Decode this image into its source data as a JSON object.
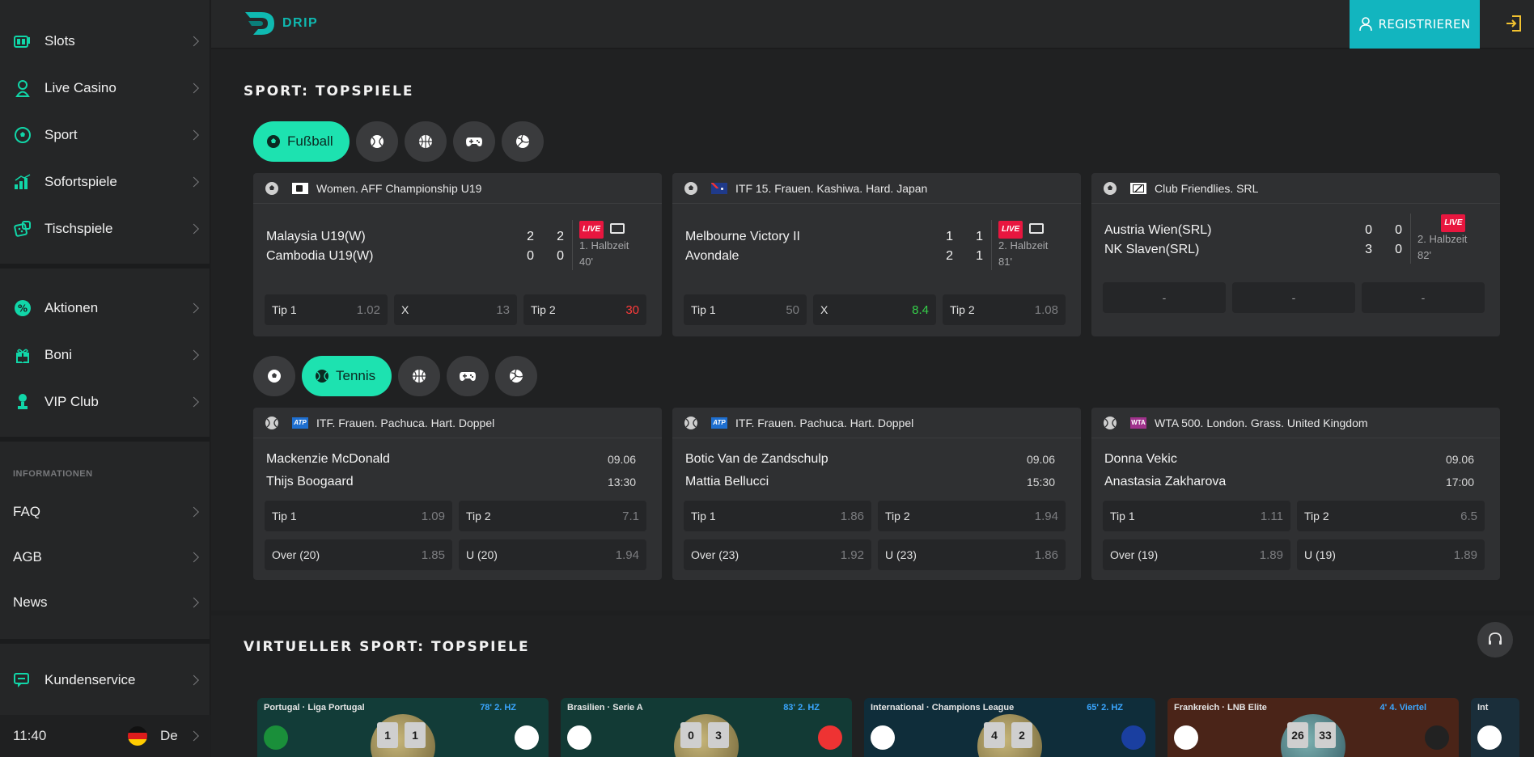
{
  "header": {
    "logo_text": "DRIP",
    "register_label": "REGISTRIEREN"
  },
  "sidebar": {
    "menu1": [
      {
        "label": "Slots",
        "icon": "slots-icon"
      },
      {
        "label": "Live Casino",
        "icon": "live-casino-icon"
      },
      {
        "label": "Sport",
        "icon": "sport-ball-icon"
      },
      {
        "label": "Sofortspiele",
        "icon": "bar-chart-icon"
      },
      {
        "label": "Tischspiele",
        "icon": "dice-icon"
      }
    ],
    "menu2": [
      {
        "label": "Aktionen",
        "icon": "percent-icon"
      },
      {
        "label": "Boni",
        "icon": "gift-icon"
      },
      {
        "label": "VIP Club",
        "icon": "trophy-icon"
      }
    ],
    "info_heading": "INFORMATIONEN",
    "menu3": [
      {
        "label": "FAQ"
      },
      {
        "label": "AGB"
      },
      {
        "label": "News"
      }
    ],
    "service": {
      "label": "Kundenservice",
      "icon": "chat-icon"
    },
    "time": "11:40",
    "lang": "De"
  },
  "sport_section": {
    "title": "SPORT: TOPSPIELE",
    "football_tab": "Fußball",
    "tennis_tab": "Tennis",
    "football_cards": [
      {
        "league": "Women. AFF Championship U19",
        "team1": "Malaysia U19(W)",
        "team2": "Cambodia U19(W)",
        "s1a": "2",
        "s1b": "2",
        "s2a": "0",
        "s2b": "0",
        "live": "LIVE",
        "period": "1. Halbzeit",
        "minute": "40'",
        "o1l": "Tip 1",
        "o1v": "1.02",
        "oxl": "X",
        "oxv": "13",
        "o2l": "Tip 2",
        "o2v": "30"
      },
      {
        "league": "ITF 15. Frauen. Kashiwa. Hard. Japan",
        "team1": "Melbourne Victory II",
        "team2": "Avondale",
        "s1a": "1",
        "s1b": "1",
        "s2a": "2",
        "s2b": "1",
        "live": "LIVE",
        "period": "2. Halbzeit",
        "minute": "81'",
        "o1l": "Tip 1",
        "o1v": "50",
        "oxl": "X",
        "oxv": "8.4",
        "o2l": "Tip 2",
        "o2v": "1.08"
      },
      {
        "league": "Club Friendlies. SRL",
        "team1": "Austria Wien(SRL)",
        "team2": "NK Slaven(SRL)",
        "s1a": "0",
        "s1b": "0",
        "s2a": "3",
        "s2b": "0",
        "live": "LIVE",
        "period": "2. Halbzeit",
        "minute": "82'",
        "e1": "-",
        "e2": "-",
        "e3": "-"
      }
    ],
    "tennis_cards": [
      {
        "league": "ITF. Frauen. Pachuca. Hart. Doppel",
        "team1": "Mackenzie McDonald",
        "team2": "Thijs Boogaard",
        "date": "09.06",
        "time": "13:30",
        "a1l": "Tip 1",
        "a1v": "1.09",
        "a2l": "Tip 2",
        "a2v": "7.1",
        "b1l": "Over (20)",
        "b1v": "1.85",
        "b2l": "U (20)",
        "b2v": "1.94"
      },
      {
        "league": "ITF. Frauen. Pachuca. Hart. Doppel",
        "team1": "Botic Van de Zandschulp",
        "team2": "Mattia Bellucci",
        "date": "09.06",
        "time": "15:30",
        "a1l": "Tip 1",
        "a1v": "1.86",
        "a2l": "Tip 2",
        "a2v": "1.94",
        "b1l": "Over (23)",
        "b1v": "1.92",
        "b2l": "U (23)",
        "b2v": "1.86"
      },
      {
        "league": "WTA 500. London. Grass. United Kingdom",
        "team1": "Donna Vekic",
        "team2": "Anastasia Zakharova",
        "date": "09.06",
        "time": "17:00",
        "a1l": "Tip 1",
        "a1v": "1.11",
        "a2l": "Tip 2",
        "a2v": "6.5",
        "b1l": "Over (19)",
        "b1v": "1.89",
        "b2l": "U (19)",
        "b2v": "1.89"
      }
    ]
  },
  "virtual_section": {
    "title": "VIRTUELLER SPORT: TOPSPIELE",
    "cards": [
      {
        "league": "Portugal · Liga Portugal",
        "minute": "78' 2. HZ",
        "s1": "1",
        "s2": "1"
      },
      {
        "league": "Brasilien · Serie A",
        "minute": "83' 2. HZ",
        "s1": "0",
        "s2": "3"
      },
      {
        "league": "International · Champions League",
        "minute": "65' 2. HZ",
        "s1": "4",
        "s2": "2"
      },
      {
        "league": "Frankreich · LNB Elite",
        "minute": "4' 4. Viertel",
        "s1": "26",
        "s2": "33"
      },
      {
        "league": "Int"
      }
    ]
  }
}
